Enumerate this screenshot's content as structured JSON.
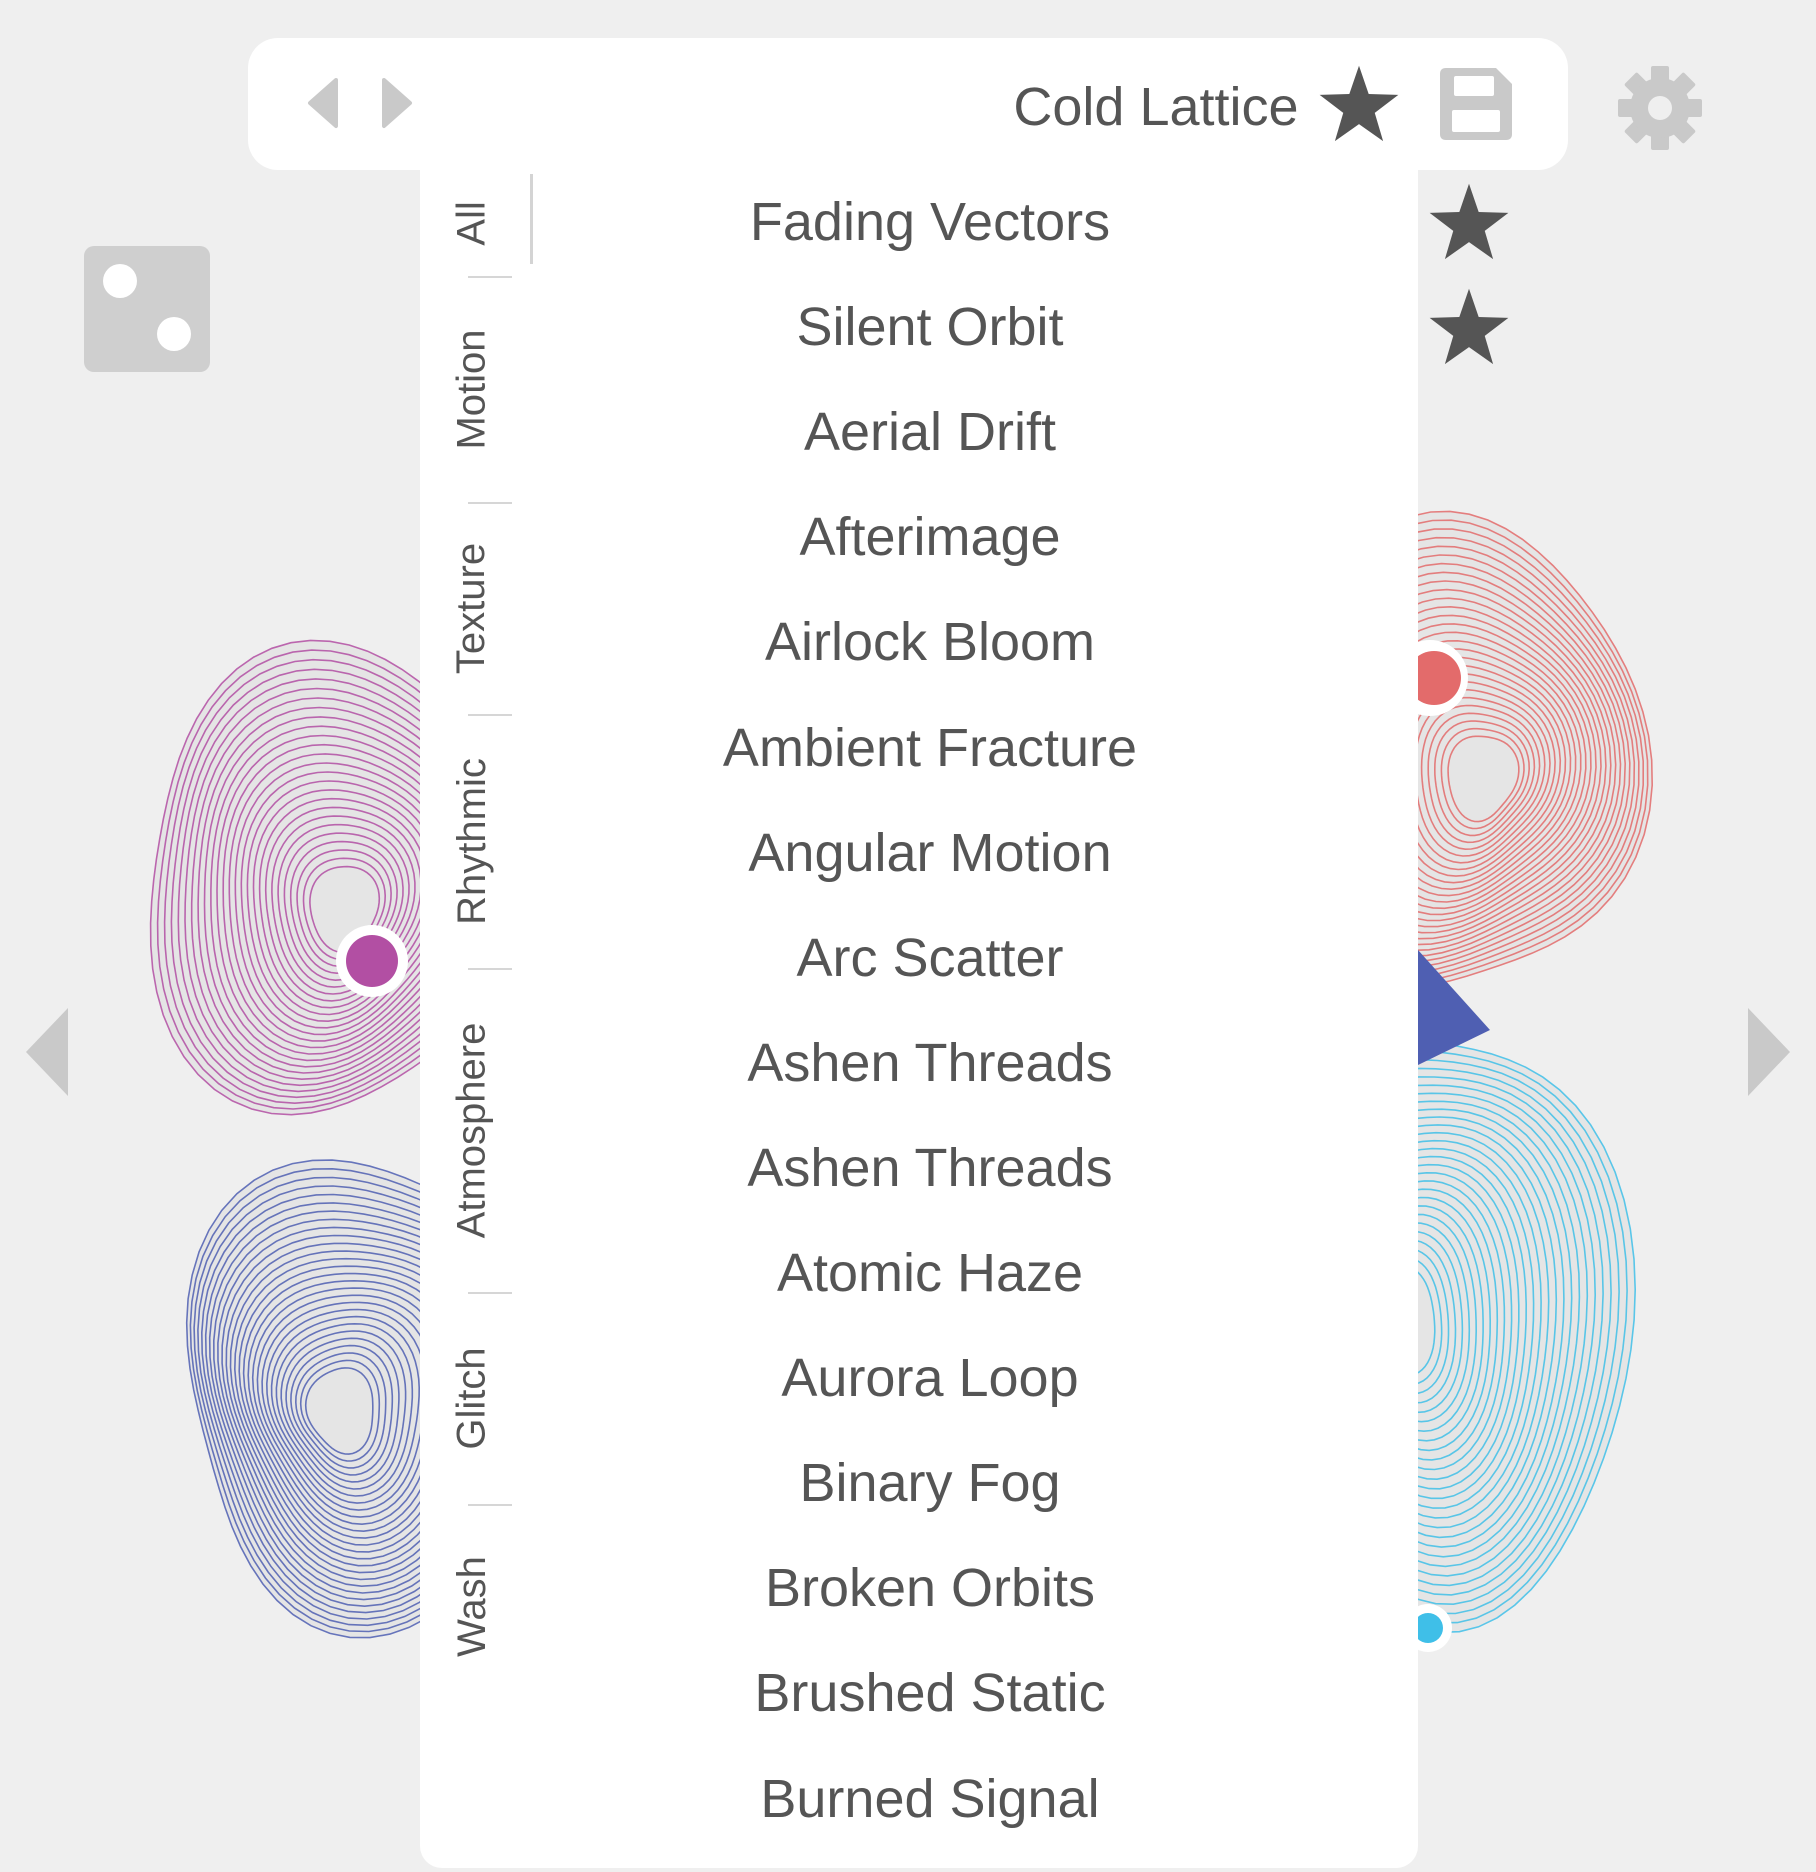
{
  "toolbar": {
    "title": "Cold Lattice",
    "prev_icon": "triangle-left",
    "next_icon": "triangle-right",
    "favorite_icon": "star",
    "save_icon": "floppy-disk",
    "settings_icon": "gear",
    "randomize_icon": "dice"
  },
  "categories": [
    {
      "label": "All"
    },
    {
      "label": "Motion"
    },
    {
      "label": "Texture"
    },
    {
      "label": "Rhythmic"
    },
    {
      "label": "Atmosphere"
    },
    {
      "label": "Glitch"
    },
    {
      "label": "Wash"
    }
  ],
  "active_category": "All",
  "presets": [
    {
      "label": "Fading Vectors",
      "favorite": true
    },
    {
      "label": "Silent Orbit",
      "favorite": true
    },
    {
      "label": "Aerial Drift",
      "favorite": false
    },
    {
      "label": "Afterimage",
      "favorite": false
    },
    {
      "label": "Airlock Bloom",
      "favorite": false
    },
    {
      "label": "Ambient Fracture",
      "favorite": false
    },
    {
      "label": "Angular Motion",
      "favorite": false
    },
    {
      "label": "Arc Scatter",
      "favorite": false
    },
    {
      "label": "Ashen Threads",
      "favorite": false
    },
    {
      "label": "Ashen Threads",
      "favorite": false
    },
    {
      "label": "Atomic Haze",
      "favorite": false
    },
    {
      "label": "Aurora Loop",
      "favorite": false
    },
    {
      "label": "Binary Fog",
      "favorite": false
    },
    {
      "label": "Broken Orbits",
      "favorite": false
    },
    {
      "label": "Brushed Static",
      "favorite": false
    },
    {
      "label": "Burned Signal",
      "favorite": false
    }
  ],
  "colors": {
    "magenta": "#b24fa3",
    "coral": "#e36b6b",
    "indigo": "#4f5fb2",
    "cyan": "#3fbfe8",
    "icon_dark": "#555555",
    "icon_light": "#c9c9c9"
  }
}
